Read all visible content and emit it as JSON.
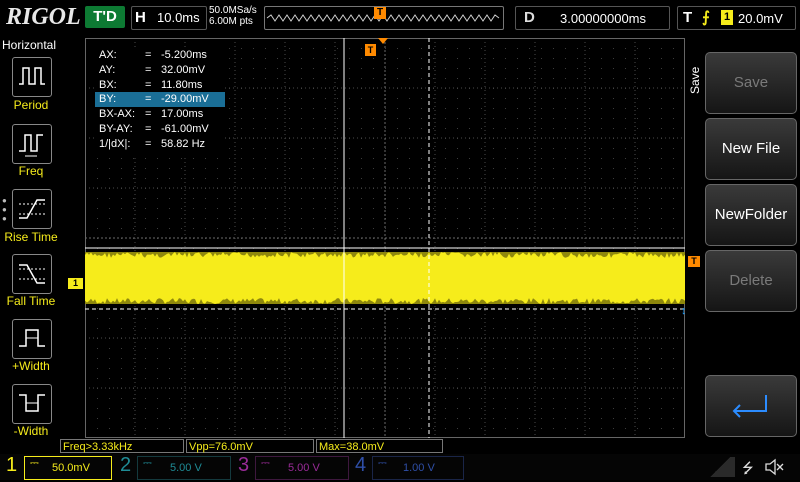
{
  "header": {
    "brand": "RIGOL",
    "trigger_status": "T'D",
    "horizontal_key": "H",
    "timebase": "10.0ms",
    "sample_rate": "50.0MSa/s",
    "memory_depth": "6.00M pts",
    "trigger_pos_marker": "T",
    "delay_key": "D",
    "delay_value": "3.00000000ms",
    "trigger_key": "T",
    "trigger_source": "1",
    "trigger_level": "20.0mV"
  },
  "left_menu": {
    "title": "Horizontal",
    "items": [
      {
        "label": "Period",
        "icon": "period-icon"
      },
      {
        "label": "Freq",
        "icon": "freq-icon"
      },
      {
        "label": "Rise Time",
        "icon": "rise-time-icon"
      },
      {
        "label": "Fall Time",
        "icon": "fall-time-icon"
      },
      {
        "label": "+Width",
        "icon": "pos-width-icon"
      },
      {
        "label": "-Width",
        "icon": "neg-width-icon"
      }
    ]
  },
  "cursor_readout": {
    "rows": [
      {
        "key": "AX:",
        "eq": "=",
        "value": "-5.200ms"
      },
      {
        "key": "AY:",
        "eq": "=",
        "value": "32.00mV"
      },
      {
        "key": "BX:",
        "eq": "=",
        "value": "11.80ms"
      },
      {
        "key": "BY:",
        "eq": "=",
        "value": "-29.00mV"
      },
      {
        "key": "BX-AX:",
        "eq": "=",
        "value": "17.00ms"
      },
      {
        "key": "BY-AY:",
        "eq": "=",
        "value": "-61.00mV"
      },
      {
        "key": "1/|dX|:",
        "eq": "=",
        "value": "58.82 Hz"
      }
    ],
    "selected_row": "BY:"
  },
  "markers": {
    "channel1": "1",
    "trigger_level": "T",
    "trigger_position": "T"
  },
  "right_menu": {
    "title": "Save",
    "buttons": {
      "save": "Save",
      "new_file": "New File",
      "new_folder": "NewFolder",
      "delete": "Delete",
      "enter_icon": "enter-icon"
    }
  },
  "measurements": [
    "Freq>3.33kHz",
    "Vpp=76.0mV",
    "Max=38.0mV"
  ],
  "channels": [
    {
      "num": "1",
      "scale": "50.0mV",
      "color": "#f6ec1b"
    },
    {
      "num": "2",
      "scale": "5.00 V",
      "color": "#1fc8d8"
    },
    {
      "num": "3",
      "scale": "5.00 V",
      "color": "#e73ce6"
    },
    {
      "num": "4",
      "scale": "1.00 V",
      "color": "#2f6bff"
    }
  ],
  "status_icons": [
    "usb-icon",
    "speaker-muted-icon"
  ],
  "colors": {
    "ch1": "#f6ec1b",
    "selection": "#1a6e96",
    "trigger_marker": "#ff8a00"
  }
}
